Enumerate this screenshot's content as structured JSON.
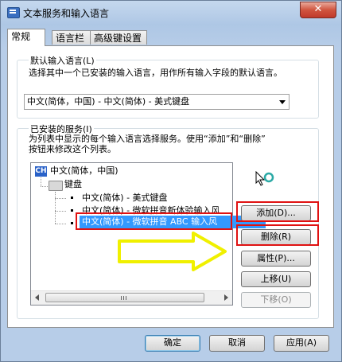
{
  "window": {
    "title": "文本服务和输入语言",
    "close_glyph": "✕"
  },
  "tabs": [
    {
      "label": "常规",
      "active": true
    },
    {
      "label": "语言栏",
      "active": false
    },
    {
      "label": "高级键设置",
      "active": false
    }
  ],
  "default_language": {
    "group_title": "默认输入语言(L)",
    "description": "选择其中一个已安装的输入语言，用作所有输入字段的默认语言。",
    "selected_value": "中文(简体，中国) - 中文(简体) - 美式键盘"
  },
  "installed_services": {
    "group_title": "已安装的服务(I)",
    "description_line1": "为列表中显示的每个输入语言选择服务。使用“添加”和“删除”",
    "description_line2": "按钮来修改这个列表。",
    "tree": {
      "language_badge": "CH",
      "language": "中文(简体，中国)",
      "category": "键盘",
      "items": [
        "中文(简体) - 美式键盘",
        "中文(简体) - 微软拼音新体验输入风",
        "中文(简体) - 微软拼音 ABC 输入风"
      ],
      "selected_index": 2
    },
    "buttons": {
      "add": "添加(D)...",
      "remove": "删除(R)",
      "properties": "属性(P)...",
      "move_up": "上移(U)",
      "move_down": "下移(O)"
    }
  },
  "footer": {
    "ok": "确定",
    "cancel": "取消",
    "apply": "应用(A)"
  },
  "annotations": {
    "highlight_color": "#e01212",
    "arrow_color": "#f0f000"
  }
}
